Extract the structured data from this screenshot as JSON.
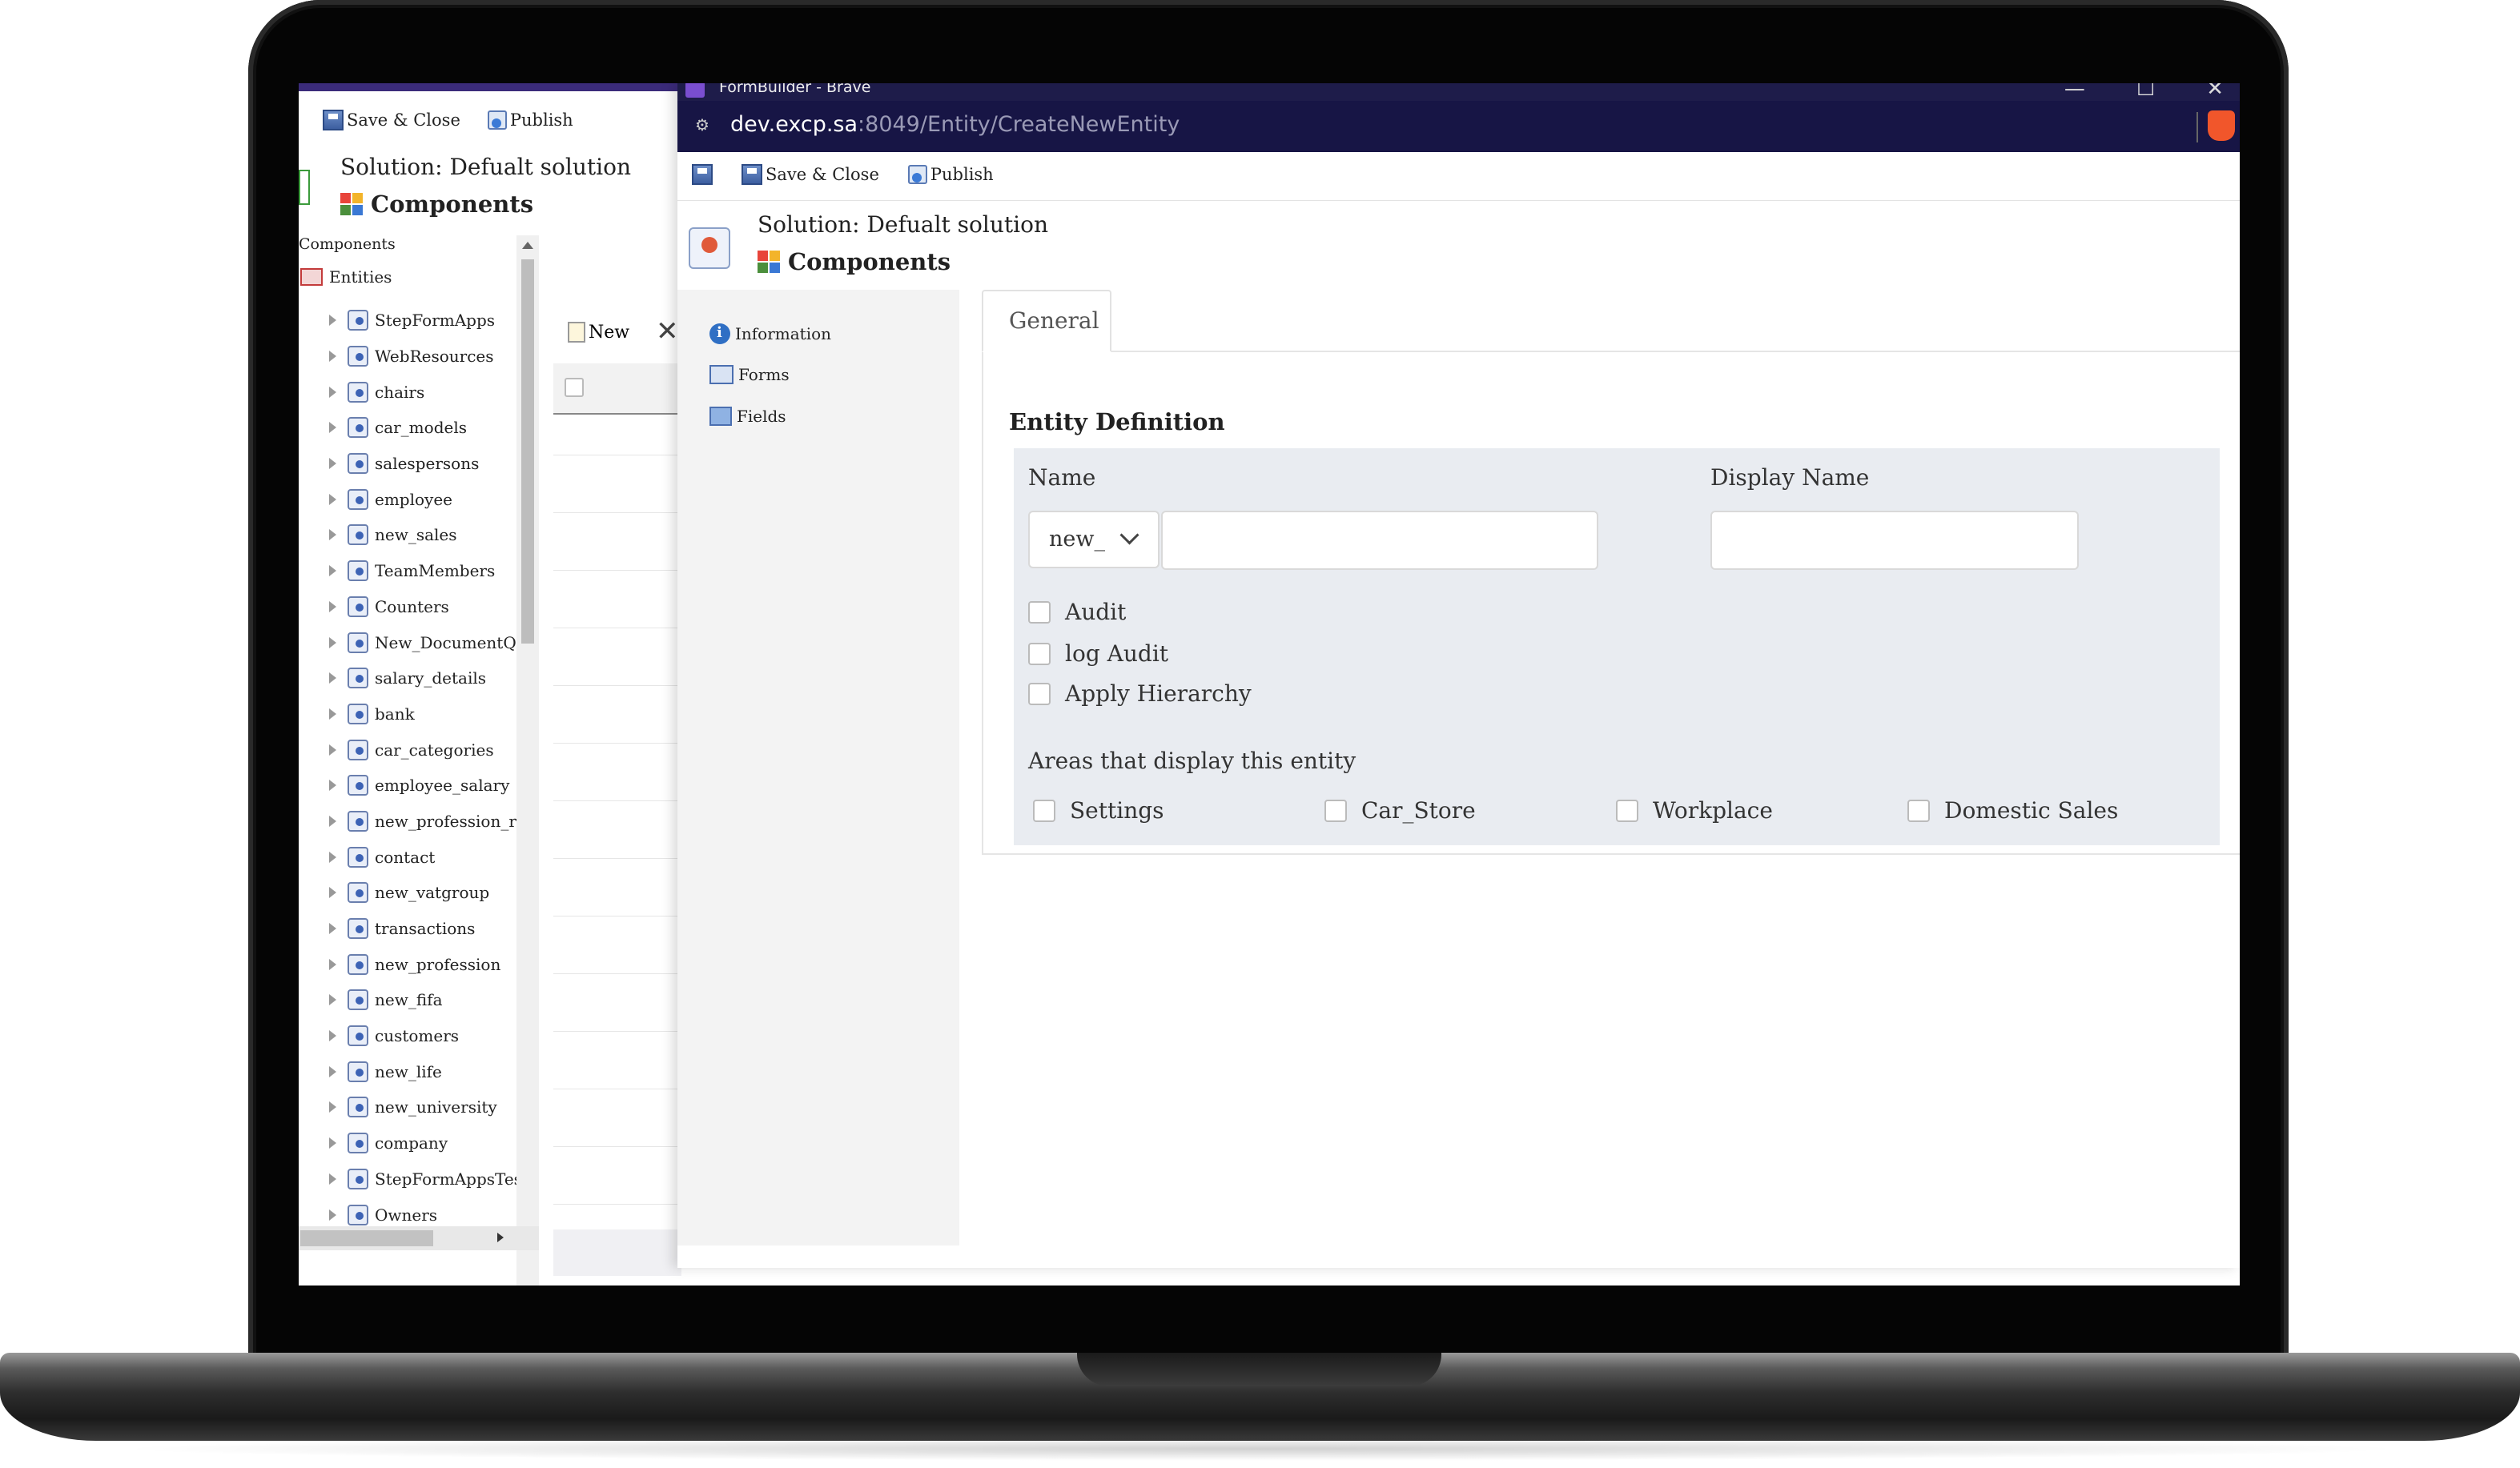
{
  "back_window": {
    "toolbar": {
      "save_close": "Save & Close",
      "publish": "Publish"
    },
    "solution": "Solution: Defualt solution",
    "components_title": "Components",
    "tree": {
      "root": "Components",
      "entities_label": "Entities",
      "items": [
        "StepFormApps",
        "WebResources",
        "chairs",
        "car_models",
        "salespersons",
        "employee",
        "new_sales",
        "TeamMembers",
        "Counters",
        "New_DocumentQu",
        "salary_details",
        "bank",
        "car_categories",
        "employee_salary",
        "new_profession_re",
        "contact",
        "new_vatgroup",
        "transactions",
        "new_profession",
        "new_fifa",
        "customers",
        "new_life",
        "new_university",
        "company",
        "StepFormAppsTest",
        "Owners"
      ]
    },
    "grid": {
      "new_label": "New",
      "close_glyph": "✕"
    }
  },
  "front_window": {
    "title": "FormBuilder - Brave",
    "window_controls": {
      "minimize": "—",
      "maximize": "☐",
      "close": "✕"
    },
    "address": {
      "host": "dev.excp.sa",
      "path": ":8049/Entity/CreateNewEntity"
    },
    "toolbar": {
      "save_close": "Save & Close",
      "publish": "Publish"
    },
    "solution": "Solution: Defualt solution",
    "components_title": "Components",
    "nav": [
      {
        "label": "Information",
        "icon": "info-icon"
      },
      {
        "label": "Forms",
        "icon": "forms-icon"
      },
      {
        "label": "Fields",
        "icon": "fields-icon"
      }
    ],
    "tab_label": "General",
    "section_title": "Entity Definition",
    "form": {
      "name_label": "Name",
      "prefix_value": "new_",
      "name_value": "",
      "display_name_label": "Display Name",
      "display_name_value": "",
      "checkboxes": [
        "Audit",
        "log Audit",
        "Apply Hierarchy"
      ],
      "areas_label": "Areas that display this entity",
      "areas": [
        "Settings",
        "Car_Store",
        "Workplace",
        "Domestic Sales"
      ]
    }
  },
  "colors": {
    "titlebar": "#1e1c4a",
    "addressbar": "#171545",
    "panel": "#e9ecf1",
    "nav_bg": "#f3f3f3",
    "brave_orange": "#f1562b"
  }
}
